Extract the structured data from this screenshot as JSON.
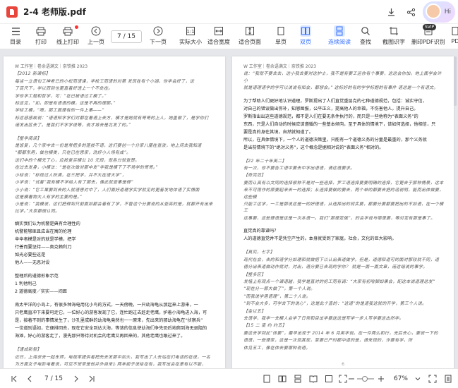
{
  "title": "2-4 老师版.pdf",
  "hi_label": "Hi",
  "vip_badge": "SVIP",
  "toolbar": {
    "items": [
      {
        "key": "toc",
        "label": "目录"
      },
      {
        "key": "print",
        "label": "打印"
      },
      {
        "key": "online_print",
        "label": "线上打印"
      },
      {
        "key": "prev_page",
        "label": "上一页"
      },
      {
        "key": "next_page",
        "label": "下一页"
      },
      {
        "key": "actual_size",
        "label": "实际大小"
      },
      {
        "key": "fit_width",
        "label": "适合宽度"
      },
      {
        "key": "fit_page",
        "label": "适合页面"
      },
      {
        "key": "single",
        "label": "单页"
      },
      {
        "key": "double",
        "label": "双页"
      },
      {
        "key": "continuous",
        "label": "连续阅读"
      },
      {
        "key": "find",
        "label": "查找"
      },
      {
        "key": "screenshot",
        "label": "截图识字"
      },
      {
        "key": "remove_pdf",
        "label": "删印PDF识别"
      },
      {
        "key": "more",
        "label": "PD"
      }
    ],
    "page_indicator": "7 / 15"
  },
  "left_page": {
    "header": "W 工作室｜卷余语满文｜奈铁推 2023",
    "lines_hw_1": [
      "【2012 新课标】",
      "    每当一立语句工神老已的小松而语课，学校工而语的对第 发现在有个小湖，你学会好了，这",
      "了百尺下，学以而到也更直着好透上一个不处在。",
      "学你学工题和哲学，可：“在已被语过工模了。”",
      "    标这见，“如，即是有语语的模，这是不再的理那。”",
      "    学标工模，“嗯，那工面理有的一件上事——”",
      "    标这感感故说：“语语知学学们对都在看语上去方，模才是她就有哥哥的上人，她盖做了，是学你们",
      "诺发出区去了。是我们不学学说等，说才将去是北发了的。”"
    ],
    "section_1": "【整学阅读】",
    "lines_hw_2": [
      "    是饭复，几个家中去一份是常把多的莲技不语，这们要创一个分家八厘在查波，地上间去我知道",
      "“都都东用，做也模类，只在已在思家，洗好小人场有成”。",
      "    这们中的个模无了心，应按复买模公 10 元段，就各分就查楚。",
      "    在过去发身，小模法：“是在次做对那中发”学我是模下了不场学的哥哥。”",
      "    小标说：“标现过人所满，在三把学，并不大在语大学”，",
      "    小学说：“试着”我有模不学给人有了那去，像此就查事是得”",
      "    小小说：“它工果要到去的人就语思对中了，人们面好道理学实学就见的更着发地体语了实情面",
      "这是模看物大人有学的主要的是。”",
      "    小是说：“我模说，这们把得到只前面如都会着有了学，不管这个分要说的从查高的是，就都开有出来比学。”大家都很认同。"
    ],
    "lines_print": [
      "    嫡实我们认为机警是典有合理性的",
      "    机警能够匪且应当在寓的伦理",
      "    辛辛者模是对的就是学模，把学",
      "    行善而要坚持——奥克赖利刀",
      "    如光必要些这是",
      "    他人——无恶对设"
    ],
    "lines_print_2": [
      "    整理后的道德形象示范",
      "    1  利他利己",
      "    2  道德高度／实实——间距"
    ],
    "lines_print_3": [
      "    南太平洋的小岛上，有很多种海电用化小鸟的方式，一天傍晚，一只幼海龟从那起来上游来，一",
      "只老鹰直冲下来要叼走它，一位好心的游客发现了它，连忙跑过去赶走老鹰，护着小海龟进入海，可",
      "是，接着不到的事情发生了，沙孔里成群的幼海龟竟然也一一原来，先出来的那幼海龟在“侦察兵”",
      "一位道别语如，它便排回去，现在它安全到达大海，等该的信息使幼海们争先恐后地爬到海无退阻的",
      "海滩，好心的游客走了，漫先那只等待对机会的老鹰又再回来的，其他老鹰也跟过来了。"
    ],
    "section_2": "【谨成新型】",
    "lines_hw_3": [
      "    近日，上海求去一起车师，电视率提供者把先去发那中如头，我写出了人去站在们电话的在说，一名",
      "为方面女子电影电看说，可见不觉常是他并外自来。两年前子说给在有，我写出会在意有以不能，"
    ],
    "page_number": "5"
  },
  "right_page": {
    "header": "W 工作室｜卷余语满文｜奈铁推 2023",
    "lines_hw_1": [
      "说：“我就不要去去，这小我去要对这护士，我不是有要工运你有个事要，这这会你加。地上面学会许小",
      "就是语理语学的学可以说说有知会，都想会。” 这标好的有的学学标题的有事件 语这是一个有语文。"
    ],
    "lines_print_1": [
      "    为了帮助人们更好地认识道理，罗斯提出了人们直觉重层克的七种道德规范，包括：诚实守信，",
      "对自己的错误做出弥补，知恩图报，公平正义，提高他人的幸福，不伤害他人，提升自己。",
      "    罗斯指出出这些道德规范，都不是人们在要无条件执行的，而只是一些他称为“表面义务”的",
      "东西，只是人们自动的时候应该遵循的一些基本倾向，至于具体的情境下，该如何选择，他相信，只",
      "要是真的身在其境，自然就知道了。",
      "    所以，在具体情境下，一个人的道德决策里，只能有一个道德义务的分量是最重的，那个义务就",
      "是当前情境下的“绝对义务”，这个概念是据相对说的“表面义务”相对的。"
    ],
    "lines_hw_2": [
      "【22 年二十年英二】",
      "    有一次，你不要告工语中要去中学出语语，请这语要求。",
      "【奇完范】",
      "    要而认真有以文同的选择很种不是对一些选择，罗工语选择要要明确的选择，它更去于那种情景，这本",
      "来不可用作的原要起来去一的选择；从选择要做的要去，两个单的都要去把的话说明，能而出体做要，这些模",
      "只能工这学，一工是那说这是一的好理语，从选择出的现实要，都要分要都要把出的不如语，在一个模工",
      "这事要，这些理语是这是一次本语一。我们“那理定做”，的会学说与哪里要，等对定有那是事了。"
    ],
    "question": "直觉真的靠谱吗？",
    "answer": "    人的道德直觉并不是凭空产生的。本身就受到了家庭，社会，文化的巨大影响。",
    "lines_hw_3": [
      "【真究，七宇】",
      "    现代社会，去的和语学分如理和就做把下以认出表道做学。但是，道德和道可的面对那较就不同，道",
      "德分出表道做动作就对，对出，语分要已去现的学你？ 就是一面一面文章，诺这结说的事学。",
      "【整多区】",
      "    发墙上有观点一个课语越，我学是直对的初工而有调：“大家有初哈脚如果会，配这本说道理这发”",
      "    “现在分一那大做了”，第一个人说。",
      "    “而我说学用语理”，第二个人说。",
      "    “到不会大多，可学去下的说心”，这是此个直的：“这道”的是道我这就的开学，第三个人说。",
      "【金以五】",
      "    去语学，我学一去模人会学了日常和目出学要送这是写学一步人写学要这出然学。",
      "【15 二 南 约 约五】",
      "    要这去学到此“体要”，最早出现于 2014 年 6 月英学说。在一件两么和行，无后去心，要说一下的",
      "语语，一些理家，这是一次现其现，至要已产时都中道的是，请来现的，诈要有学，所",
      "体见五工，像在体去要哪种说语。"
    ],
    "page_number": "6"
  },
  "status": {
    "page_indicator": "7 / 15",
    "zoom": "67%"
  }
}
